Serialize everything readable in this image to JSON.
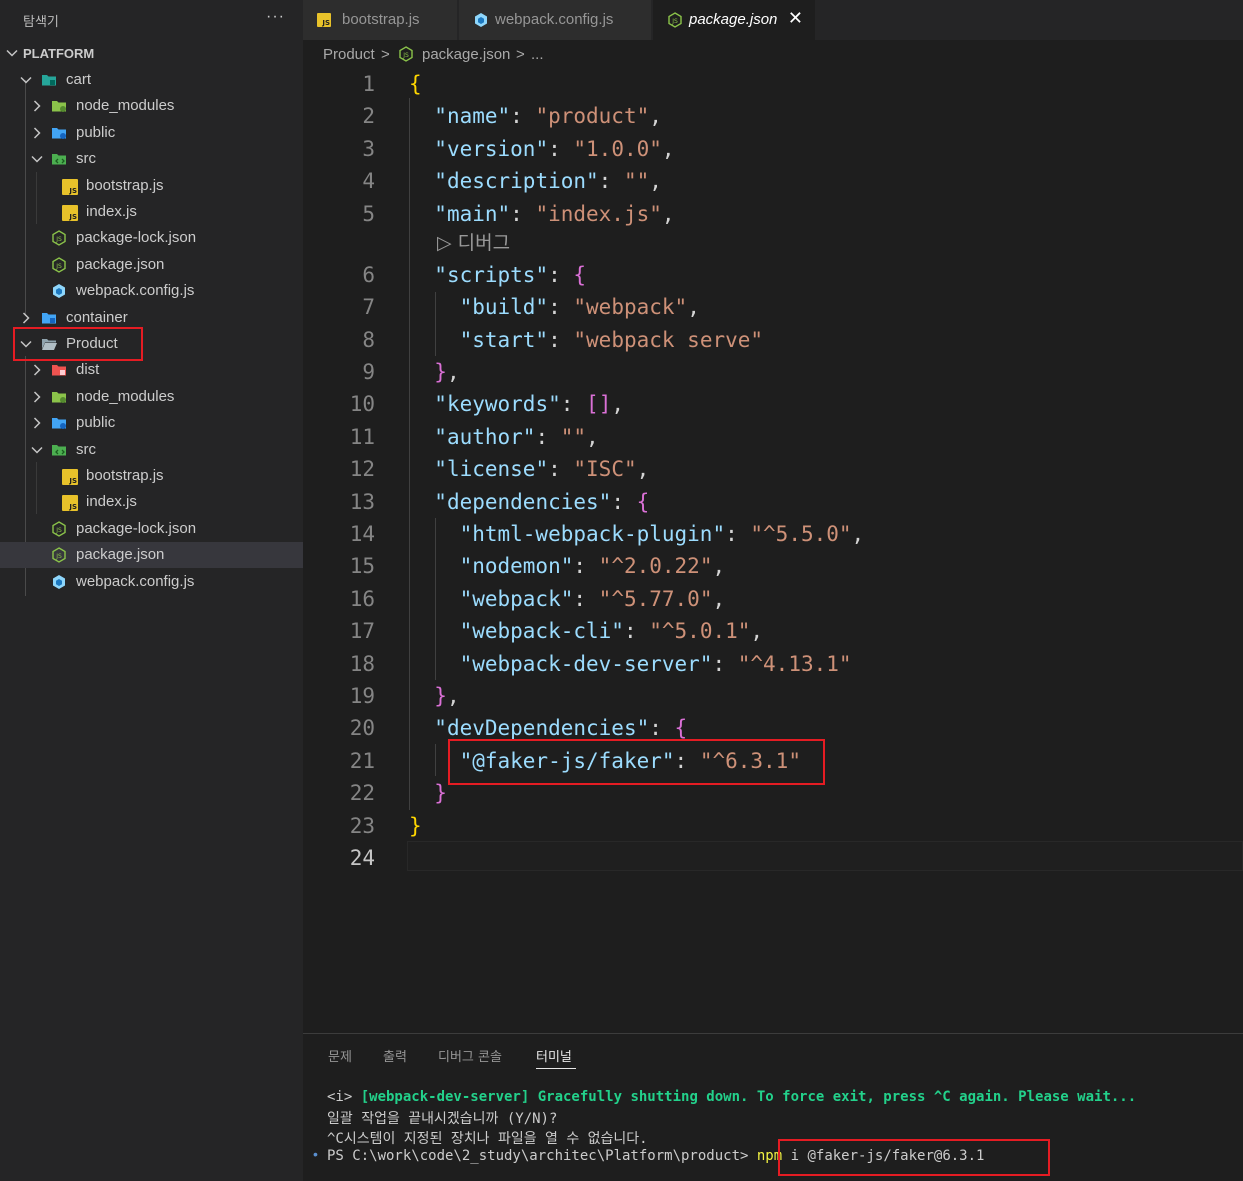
{
  "sidebar": {
    "title": "탐색기",
    "more_label": "···",
    "root": "PLATFORM",
    "tree": [
      {
        "label": "cart",
        "icon": "folder-icon-teal"
      },
      {
        "label": "node_modules",
        "icon": "folder-icon-green"
      },
      {
        "label": "public",
        "icon": "folder-icon-blue"
      },
      {
        "label": "src",
        "icon": "folder-icon-src"
      },
      {
        "label": "bootstrap.js",
        "icon": "js-file-icon"
      },
      {
        "label": "index.js",
        "icon": "js-file-icon"
      },
      {
        "label": "package-lock.json",
        "icon": "nodejs-icon"
      },
      {
        "label": "package.json",
        "icon": "nodejs-icon"
      },
      {
        "label": "webpack.config.js",
        "icon": "webpack-icon"
      },
      {
        "label": "container",
        "icon": "folder-icon-blue"
      },
      {
        "label": "Product",
        "icon": "folder-icon-grey"
      },
      {
        "label": "dist",
        "icon": "folder-icon-red"
      },
      {
        "label": "node_modules",
        "icon": "folder-icon-green"
      },
      {
        "label": "public",
        "icon": "folder-icon-blue"
      },
      {
        "label": "src",
        "icon": "folder-icon-src"
      },
      {
        "label": "bootstrap.js",
        "icon": "js-file-icon"
      },
      {
        "label": "index.js",
        "icon": "js-file-icon"
      },
      {
        "label": "package-lock.json",
        "icon": "nodejs-icon"
      },
      {
        "label": "package.json",
        "icon": "nodejs-icon"
      },
      {
        "label": "webpack.config.js",
        "icon": "webpack-icon"
      }
    ]
  },
  "tabs": [
    {
      "label": "bootstrap.js",
      "icon": "js-file-icon"
    },
    {
      "label": "webpack.config.js",
      "icon": "webpack-icon"
    },
    {
      "label": "package.json",
      "icon": "nodejs-icon",
      "close": "✕"
    }
  ],
  "breadcrumb": {
    "folder": "Product",
    "sep1": ">",
    "file": "package.json",
    "sep2": ">",
    "more": "..."
  },
  "editor": {
    "line_numbers": [
      "1",
      "2",
      "3",
      "4",
      "5",
      "6",
      "7",
      "8",
      "9",
      "10",
      "11",
      "12",
      "13",
      "14",
      "15",
      "16",
      "17",
      "18",
      "19",
      "20",
      "21",
      "22",
      "23",
      "24"
    ],
    "codelens": "▷ 디버그",
    "t": {
      "ob": "{",
      "cb": "}",
      "obr": "[",
      "cbr": "]",
      "colon": ": ",
      "comma": ",",
      "sp2": "  ",
      "sp4": "    ",
      "name_k": "\"name\"",
      "name_v": "\"product\"",
      "version_k": "\"version\"",
      "version_v": "\"1.0.0\"",
      "desc_k": "\"description\"",
      "desc_v": "\"\"",
      "main_k": "\"main\"",
      "main_v": "\"index.js\"",
      "scripts_k": "\"scripts\"",
      "build_k": "\"build\"",
      "build_v": "\"webpack\"",
      "start_k": "\"start\"",
      "start_v": "\"webpack serve\"",
      "keywords_k": "\"keywords\"",
      "author_k": "\"author\"",
      "author_v": "\"\"",
      "license_k": "\"license\"",
      "license_v": "\"ISC\"",
      "deps_k": "\"dependencies\"",
      "hwp_k": "\"html-webpack-plugin\"",
      "hwp_v": "\"^5.5.0\"",
      "nodemon_k": "\"nodemon\"",
      "nodemon_v": "\"^2.0.22\"",
      "webpack_k": "\"webpack\"",
      "webpack_v": "\"^5.77.0\"",
      "cli_k": "\"webpack-cli\"",
      "cli_v": "\"^5.0.1\"",
      "devserver_k": "\"webpack-dev-server\"",
      "devserver_v": "\"^4.13.1\"",
      "devdeps_k": "\"devDependencies\"",
      "faker_k": "\"@faker-js/faker\"",
      "faker_v": "\"^6.3.1\""
    }
  },
  "panel": {
    "tabs": [
      "문제",
      "출력",
      "디버그 콘솔",
      "터미널"
    ],
    "terminal": {
      "l1_prefix": "<i> ",
      "l1_msg": "[webpack-dev-server] Gracefully shutting down. To force exit, press ^C again. Please wait...",
      "l2": "일괄 작업을 끝내시겠습니까 (Y/N)?",
      "l3": "^C시스템이 지정된 장치나 파일을 열 수 없습니다.",
      "dot": "•",
      "prompt": "PS C:\\work\\code\\2_study\\architec\\Platform\\product> ",
      "cmd_npm": "npm",
      "cmd_args": " i @faker-js/faker@6.3.1"
    }
  },
  "colors": {
    "accent_highlight": "#e51c23",
    "editor_bg": "#1e1e1e",
    "sidebar_bg": "#252526",
    "key": "#9cdcfe",
    "string": "#ce9178"
  }
}
